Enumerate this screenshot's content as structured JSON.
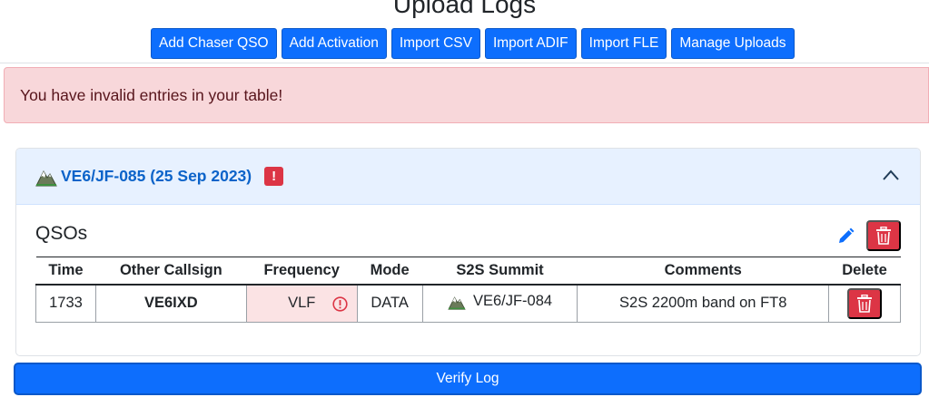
{
  "page": {
    "title": "Upload Logs"
  },
  "toolbar": {
    "buttons": [
      {
        "label": "Add Chaser QSO"
      },
      {
        "label": "Add Activation"
      },
      {
        "label": "Import CSV"
      },
      {
        "label": "Import ADIF"
      },
      {
        "label": "Import FLE"
      },
      {
        "label": "Manage Uploads"
      }
    ]
  },
  "alert": {
    "message": "You have invalid entries in your table!"
  },
  "activation": {
    "title": "VE6/JF-085 (25 Sep 2023)",
    "warning_badge": "!",
    "section_heading": "QSOs",
    "table": {
      "headers": [
        "Time",
        "Other Callsign",
        "Frequency",
        "Mode",
        "S2S Summit",
        "Comments",
        "Delete"
      ],
      "rows": [
        {
          "time": "1733",
          "callsign": "VE6IXD",
          "frequency": "VLF",
          "mode": "DATA",
          "s2s_summit": "VE6/JF-084",
          "comments": "S2S 2200m band on FT8"
        }
      ]
    }
  },
  "footer": {
    "verify_label": "Verify Log"
  },
  "colors": {
    "primary": "#0d6efd",
    "danger": "#dc3545",
    "alert_bg": "#f8d7da",
    "header_bg": "#e7f1ff"
  },
  "icons": [
    "summit-icon",
    "warning-badge-icon",
    "chevron-up-icon",
    "pencil-icon",
    "trash-icon",
    "warning-circle-icon"
  ]
}
